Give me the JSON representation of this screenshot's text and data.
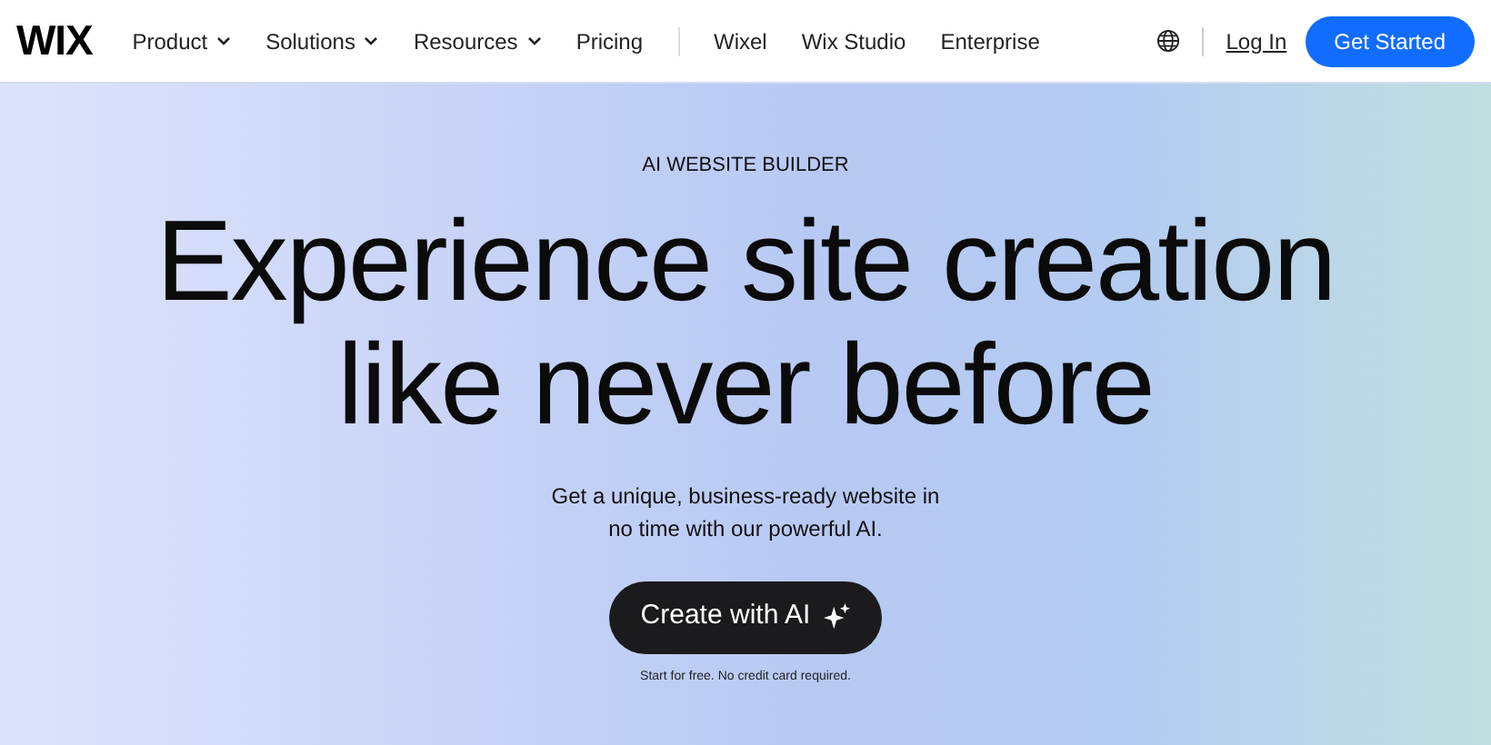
{
  "header": {
    "logo": "WIX",
    "nav": [
      {
        "label": "Product",
        "kind": "dropdown"
      },
      {
        "label": "Solutions",
        "kind": "dropdown"
      },
      {
        "label": "Resources",
        "kind": "dropdown"
      },
      {
        "label": "Pricing",
        "kind": "link"
      },
      {
        "kind": "divider"
      },
      {
        "label": "Wixel",
        "kind": "link"
      },
      {
        "label": "Wix Studio",
        "kind": "link"
      },
      {
        "label": "Enterprise",
        "kind": "link"
      }
    ],
    "login": "Log In",
    "cta": "Get Started"
  },
  "hero": {
    "eyebrow": "AI WEBSITE BUILDER",
    "title_lines": [
      "Experience site creation",
      "like never before"
    ],
    "subtitle_lines": [
      "Get a unique, business-ready website in",
      "no time with our powerful AI."
    ],
    "button": "Create with AI",
    "note": "Start for free. No credit card required."
  }
}
